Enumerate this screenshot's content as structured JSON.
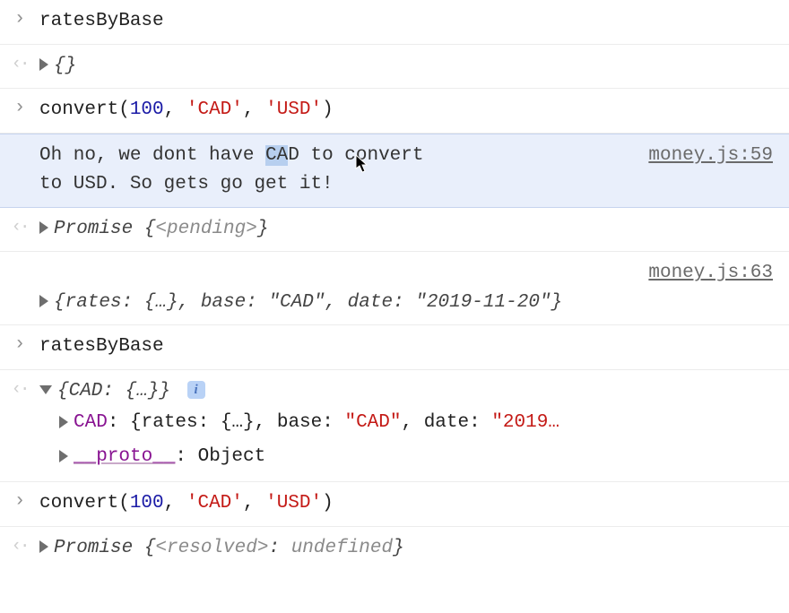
{
  "rows": {
    "r0_input": "ratesByBase",
    "r1_out": "{}",
    "r2_fn": "convert",
    "r2_arg1": "100",
    "r2_arg2": "'CAD'",
    "r2_arg3": "'USD'",
    "r3_msg_a": "Oh no, we dont have ",
    "r3_msg_hi": "CA",
    "r3_msg_b": "D to convert ",
    "r3_msg_c": "to USD. So gets go get it!",
    "r3_src": "money.js:59",
    "r4_promise": "Promise",
    "r4_state": "<pending>",
    "r5_src": "money.js:63",
    "r5_prefix": "{rates: {…}, base: ",
    "r5_base": "\"CAD\"",
    "r5_mid": ", date: ",
    "r5_date": "\"2019-11-20\"",
    "r5_suffix": "}",
    "r6_input": "ratesByBase",
    "r7_summary_a": "{CAD: {…}}",
    "r7_cad_key": "CAD",
    "r7_cad_body_a": ": {rates: {…}, base: ",
    "r7_cad_base": "\"CAD\"",
    "r7_cad_body_b": ", date: ",
    "r7_cad_date": "\"2019…",
    "r7_proto_key": "__proto__",
    "r7_proto_val": ": Object",
    "r8_fn": "convert",
    "r8_arg1": "100",
    "r8_arg2": "'CAD'",
    "r8_arg3": "'USD'",
    "r9_promise": "Promise",
    "r9_state": "<resolved>",
    "r9_val": "undefined"
  }
}
